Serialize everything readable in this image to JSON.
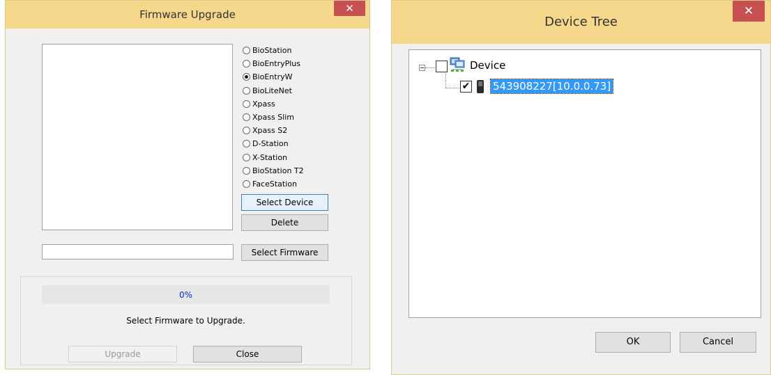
{
  "firmware_window": {
    "title": "Firmware Upgrade",
    "close_glyph": "✕",
    "device_types": [
      {
        "label": "BioStation",
        "selected": false
      },
      {
        "label": "BioEntryPlus",
        "selected": false
      },
      {
        "label": "BioEntryW",
        "selected": true
      },
      {
        "label": "BioLiteNet",
        "selected": false
      },
      {
        "label": "Xpass",
        "selected": false
      },
      {
        "label": "Xpass Slim",
        "selected": false
      },
      {
        "label": "Xpass S2",
        "selected": false
      },
      {
        "label": "D-Station",
        "selected": false
      },
      {
        "label": "X-Station",
        "selected": false
      },
      {
        "label": "BioStation T2",
        "selected": false
      },
      {
        "label": "FaceStation",
        "selected": false
      }
    ],
    "select_device_label": "Select Device",
    "delete_label": "Delete",
    "firmware_path_value": "",
    "select_firmware_label": "Select Firmware",
    "progress_percent": 0,
    "progress_text": "0%",
    "status_text": "Select Firmware to Upgrade.",
    "upgrade_label": "Upgrade",
    "close_label": "Close"
  },
  "device_tree_window": {
    "title": "Device Tree",
    "close_glyph": "✕",
    "root": {
      "label": "Device",
      "checked": false,
      "expanded": true,
      "icon": "network-computers-icon"
    },
    "child": {
      "label": "543908227[10.0.0.73]",
      "checked": true,
      "icon": "device-terminal-icon"
    },
    "ok_label": "OK",
    "cancel_label": "Cancel"
  },
  "colors": {
    "titlebar": "#f5d88c",
    "close_button": "#c75050",
    "progress_track": "#99ccff",
    "tree_selection": "#3399ff"
  }
}
